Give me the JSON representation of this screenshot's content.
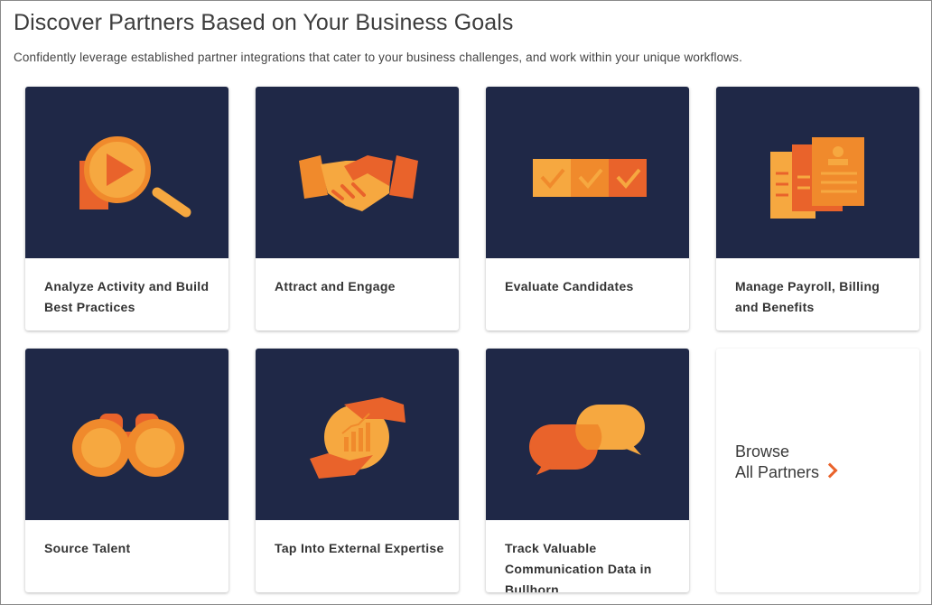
{
  "header": {
    "title": "Discover Partners Based on Your Business Goals",
    "subtitle": "Confidently leverage established partner integrations that cater to your business challenges, and work within your unique workflows."
  },
  "colors": {
    "card_art_background": "#1f2847",
    "accent_orange": "#e9632b",
    "light_orange": "#f6a840"
  },
  "cards": [
    {
      "label": "Analyze Activity and Build Best Practices",
      "icon": "magnifier-play-icon"
    },
    {
      "label": "Attract and Engage",
      "icon": "handshake-icon"
    },
    {
      "label": "Evaluate Candidates",
      "icon": "checkmarks-icon"
    },
    {
      "label": "Manage Payroll, Billing and Benefits",
      "icon": "documents-icon"
    },
    {
      "label": "Source Talent",
      "icon": "binoculars-icon"
    },
    {
      "label": "Tap Into External Expertise",
      "icon": "hands-growth-icon"
    },
    {
      "label": "Track Valuable Communication Data in Bullhorn",
      "icon": "chat-bubbles-icon"
    }
  ],
  "browse": {
    "line1": "Browse",
    "line2": "All Partners",
    "icon": "chevron-right-icon"
  }
}
